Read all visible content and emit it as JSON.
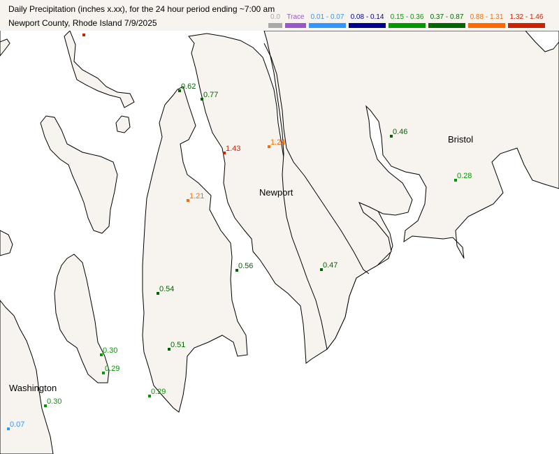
{
  "header": {
    "title_line1": "Daily Precipitation (inches  x.xx),  for the 24 hour period ending ~7:00 am",
    "title_line2": "Newport County, Rhode Island  7/9/2025"
  },
  "legend": [
    {
      "label": "0.0",
      "color": "#a9a9a9",
      "text_color": "#a9a9a9"
    },
    {
      "label": "Trace",
      "color": "#9955cc",
      "text_color": "#9955cc"
    },
    {
      "label": "0.01 - 0.07",
      "color": "#2f97ff",
      "text_color": "#2f97ff"
    },
    {
      "label": "0.08 - 0.14",
      "color": "#00008f",
      "text_color": "#00008f"
    },
    {
      "label": "0.15 - 0.36",
      "color": "#009900",
      "text_color": "#009900"
    },
    {
      "label": "0.37 - 0.87",
      "color": "#006600",
      "text_color": "#006600"
    },
    {
      "label": "0.88 - 1.31",
      "color": "#ff6a00",
      "text_color": "#ff6a00"
    },
    {
      "label": "1.32 - 1.46",
      "color": "#cc2200",
      "text_color": "#cc2200"
    }
  ],
  "map": {
    "land_color": "#f7f4ef",
    "water_color": "#ffffff",
    "border_color": "#000000",
    "region_labels": [
      {
        "id": "newport",
        "text": "Newport"
      },
      {
        "id": "bristol",
        "text": "Bristol"
      },
      {
        "id": "washington",
        "text": "Washington"
      }
    ]
  },
  "stations": [
    {
      "value": "0.62",
      "color": "#006600"
    },
    {
      "value": "0.77",
      "color": "#006600"
    },
    {
      "value": "1.43",
      "color": "#cc2200"
    },
    {
      "value": "1.24",
      "color": "#ff6a00"
    },
    {
      "value": "1.21",
      "color": "#ff6a00"
    },
    {
      "value": "0.56",
      "color": "#006600"
    },
    {
      "value": "0.47",
      "color": "#006600"
    },
    {
      "value": "0.54",
      "color": "#006600"
    },
    {
      "value": "0.51",
      "color": "#006600"
    },
    {
      "value": "0.46",
      "color": "#006600"
    },
    {
      "value": "0.28",
      "color": "#009900"
    },
    {
      "value": "0.30",
      "color": "#009900"
    },
    {
      "value": "0.29",
      "color": "#009900"
    },
    {
      "value": "0.29",
      "color": "#009900"
    },
    {
      "value": "0.30",
      "color": "#009900"
    },
    {
      "value": "0.07",
      "color": "#2f97ff"
    }
  ]
}
